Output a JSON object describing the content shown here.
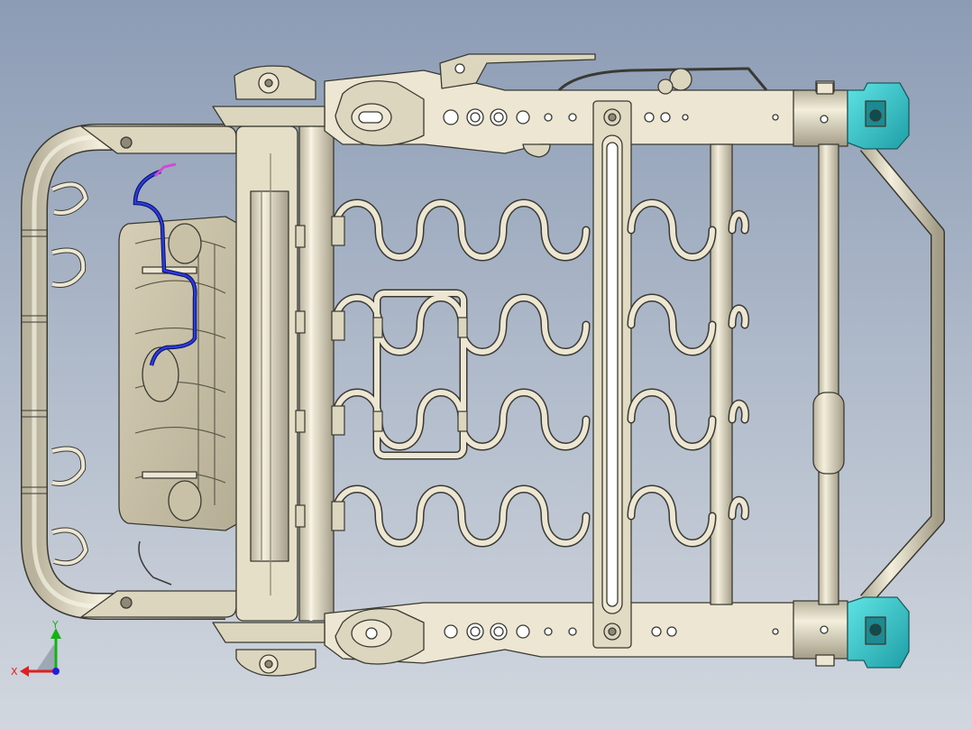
{
  "viewport": {
    "background_top": "#8c9cb5",
    "background_bottom": "#d2d7df",
    "model_color": "#ece6d2",
    "model_edge": "#3a3a32",
    "latch_color": "#2ec9cc",
    "harness_wire_color": "#1a2ac0",
    "connector_color": "#d24ad8"
  },
  "triad": {
    "x_label": "X",
    "y_label": "Y",
    "x_color": "#e02020",
    "y_color": "#18b018",
    "z_color": "#2020d8"
  }
}
